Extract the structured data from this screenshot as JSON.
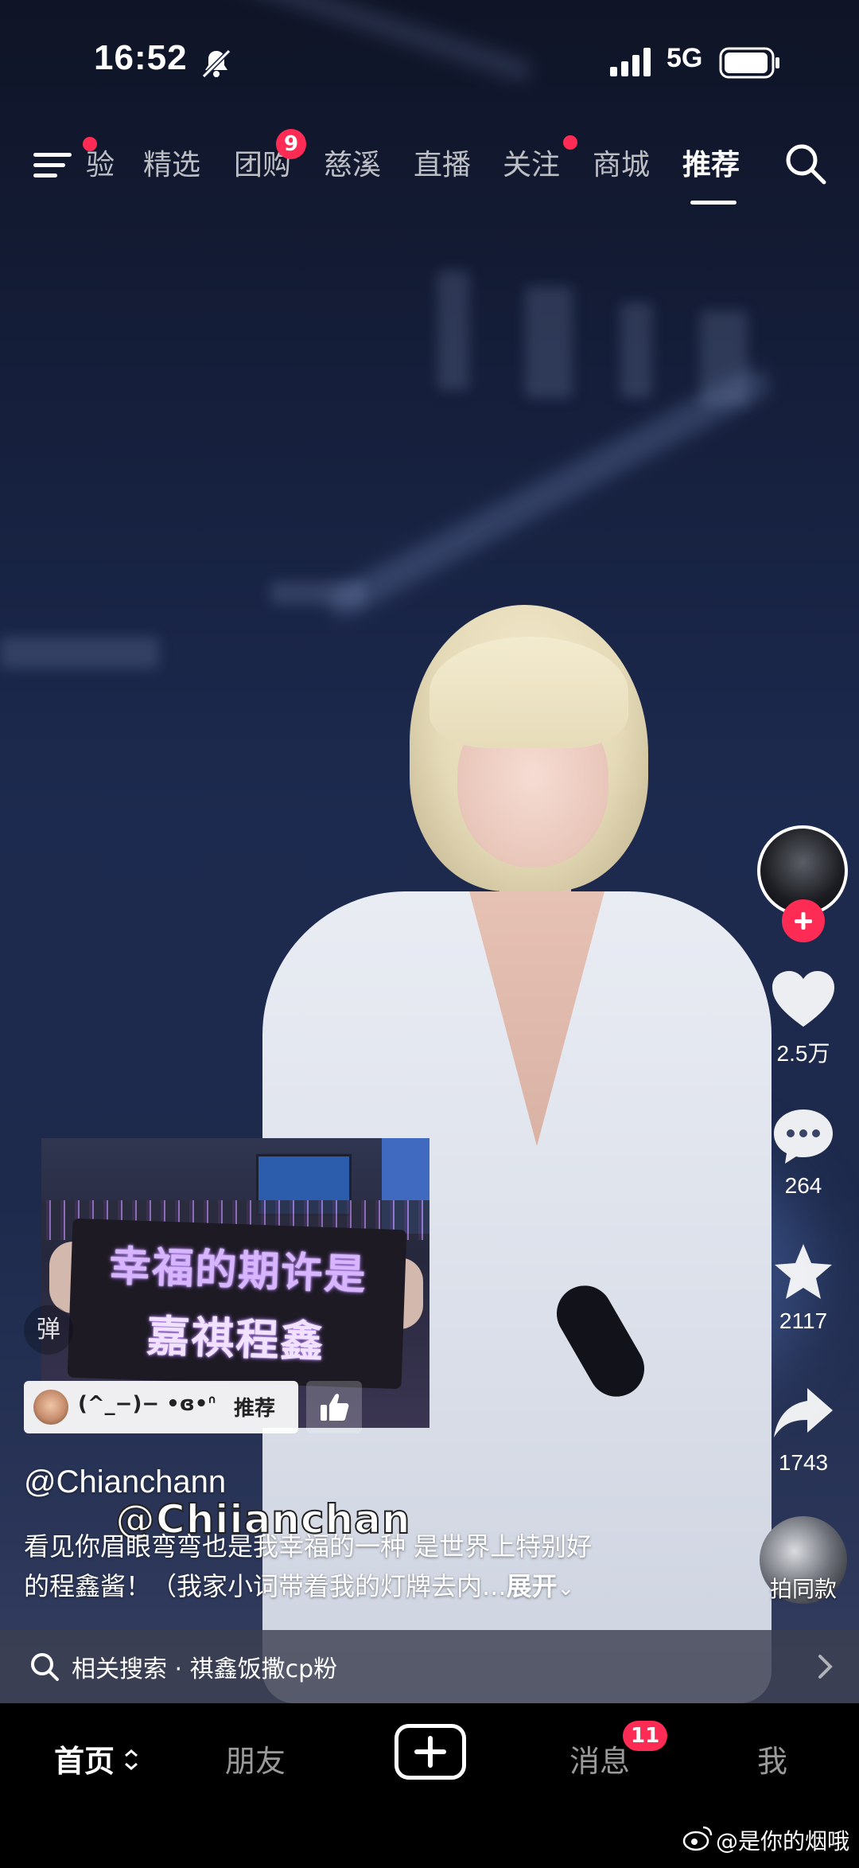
{
  "status_bar": {
    "time": "16:52",
    "network": "5G"
  },
  "top_nav": {
    "tabs": [
      {
        "label": "验",
        "partial": true
      },
      {
        "label": "精选"
      },
      {
        "label": "团购",
        "badge": "9"
      },
      {
        "label": "慈溪"
      },
      {
        "label": "直播"
      },
      {
        "label": "关注",
        "dot": true
      },
      {
        "label": "商城"
      },
      {
        "label": "推荐",
        "active": true
      }
    ],
    "menu_dot": true
  },
  "actions": {
    "like_count": "2.5万",
    "comment_count": "264",
    "favorite_count": "2117",
    "share_count": "1743",
    "same_style_label": "拍同款"
  },
  "inset": {
    "sign_line1": "幸福的期许是",
    "sign_line2": "嘉祺程鑫",
    "user": "(^_−)− •ɞ•ᐢ",
    "tag": "推荐",
    "danmu_label": "弹"
  },
  "caption": {
    "author": "@Chianchann",
    "watermark": "@Chiianchan",
    "line1": "看见你眉眼弯弯也是我幸福的一种 是世界上特别好",
    "line2": "的程鑫酱！（我家小词带着我的灯牌去内...",
    "expand": "展开"
  },
  "related_search": {
    "label": "相关搜索 · 祺鑫饭撒cp粉"
  },
  "bottom_nav": {
    "home": "首页",
    "friends": "朋友",
    "messages": "消息",
    "messages_badge": "11",
    "me": "我",
    "credit": "@是你的烟哦"
  },
  "colors": {
    "accent": "#fe2c55",
    "nav_bg": "#000000"
  },
  "icons": [
    "mute-icon",
    "signal-icon",
    "battery-icon",
    "menu-icon",
    "search-icon",
    "heart-icon",
    "comment-icon",
    "star-icon",
    "share-icon",
    "plus-icon",
    "weibo-icon"
  ]
}
